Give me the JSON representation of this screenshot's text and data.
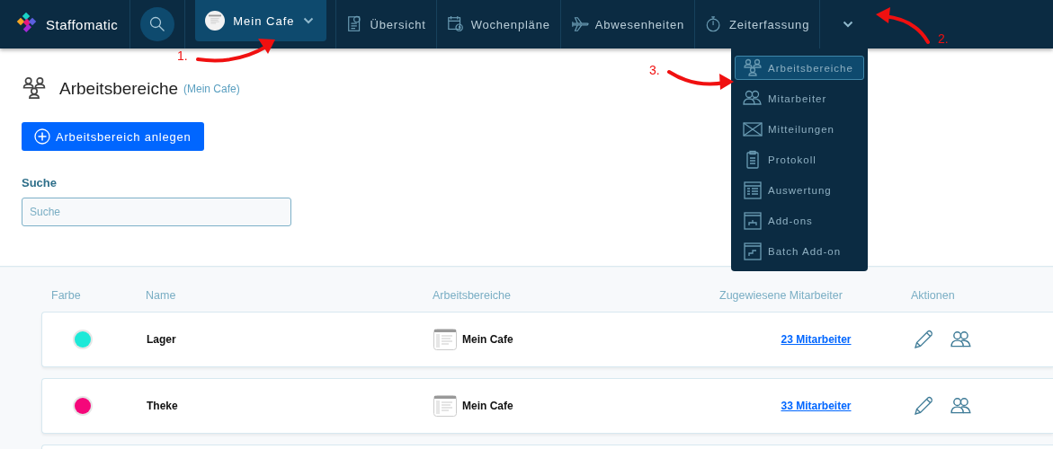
{
  "brand": "Staffomatic",
  "location_button": {
    "label": "Mein Cafe"
  },
  "nav": [
    {
      "label": "Übersicht"
    },
    {
      "label": "Wochenpläne"
    },
    {
      "label": "Abwesenheiten"
    },
    {
      "label": "Zeiterfassung"
    }
  ],
  "more_menu": {
    "expanded": true,
    "items": [
      {
        "label": "Arbeitsbereiche",
        "selected": true
      },
      {
        "label": "Mitarbeiter",
        "selected": false
      },
      {
        "label": "Mitteilungen",
        "selected": false
      },
      {
        "label": "Protokoll",
        "selected": false
      },
      {
        "label": "Auswertung",
        "selected": false
      },
      {
        "label": "Add-ons",
        "selected": false
      },
      {
        "label": "Batch Add-on",
        "selected": false
      }
    ]
  },
  "page": {
    "title": "Arbeitsbereiche",
    "subtitle": "(Mein Cafe)",
    "add_button": "Arbeitsbereich anlegen",
    "search_label": "Suche",
    "search_placeholder": "Suche"
  },
  "table": {
    "columns": [
      "Farbe",
      "Name",
      "Arbeitsbereiche",
      "Zugewiesene Mitarbeiter",
      "Aktionen"
    ],
    "rows": [
      {
        "color": "#1de9d8",
        "name": "Lager",
        "location": "Mein Cafe",
        "employees": "23 Mitarbeiter"
      },
      {
        "color": "#f5077a",
        "name": "Theke",
        "location": "Mein Cafe",
        "employees": "33 Mitarbeiter"
      }
    ]
  },
  "annotations": [
    {
      "label": "1."
    },
    {
      "label": "2."
    },
    {
      "label": "3."
    }
  ]
}
